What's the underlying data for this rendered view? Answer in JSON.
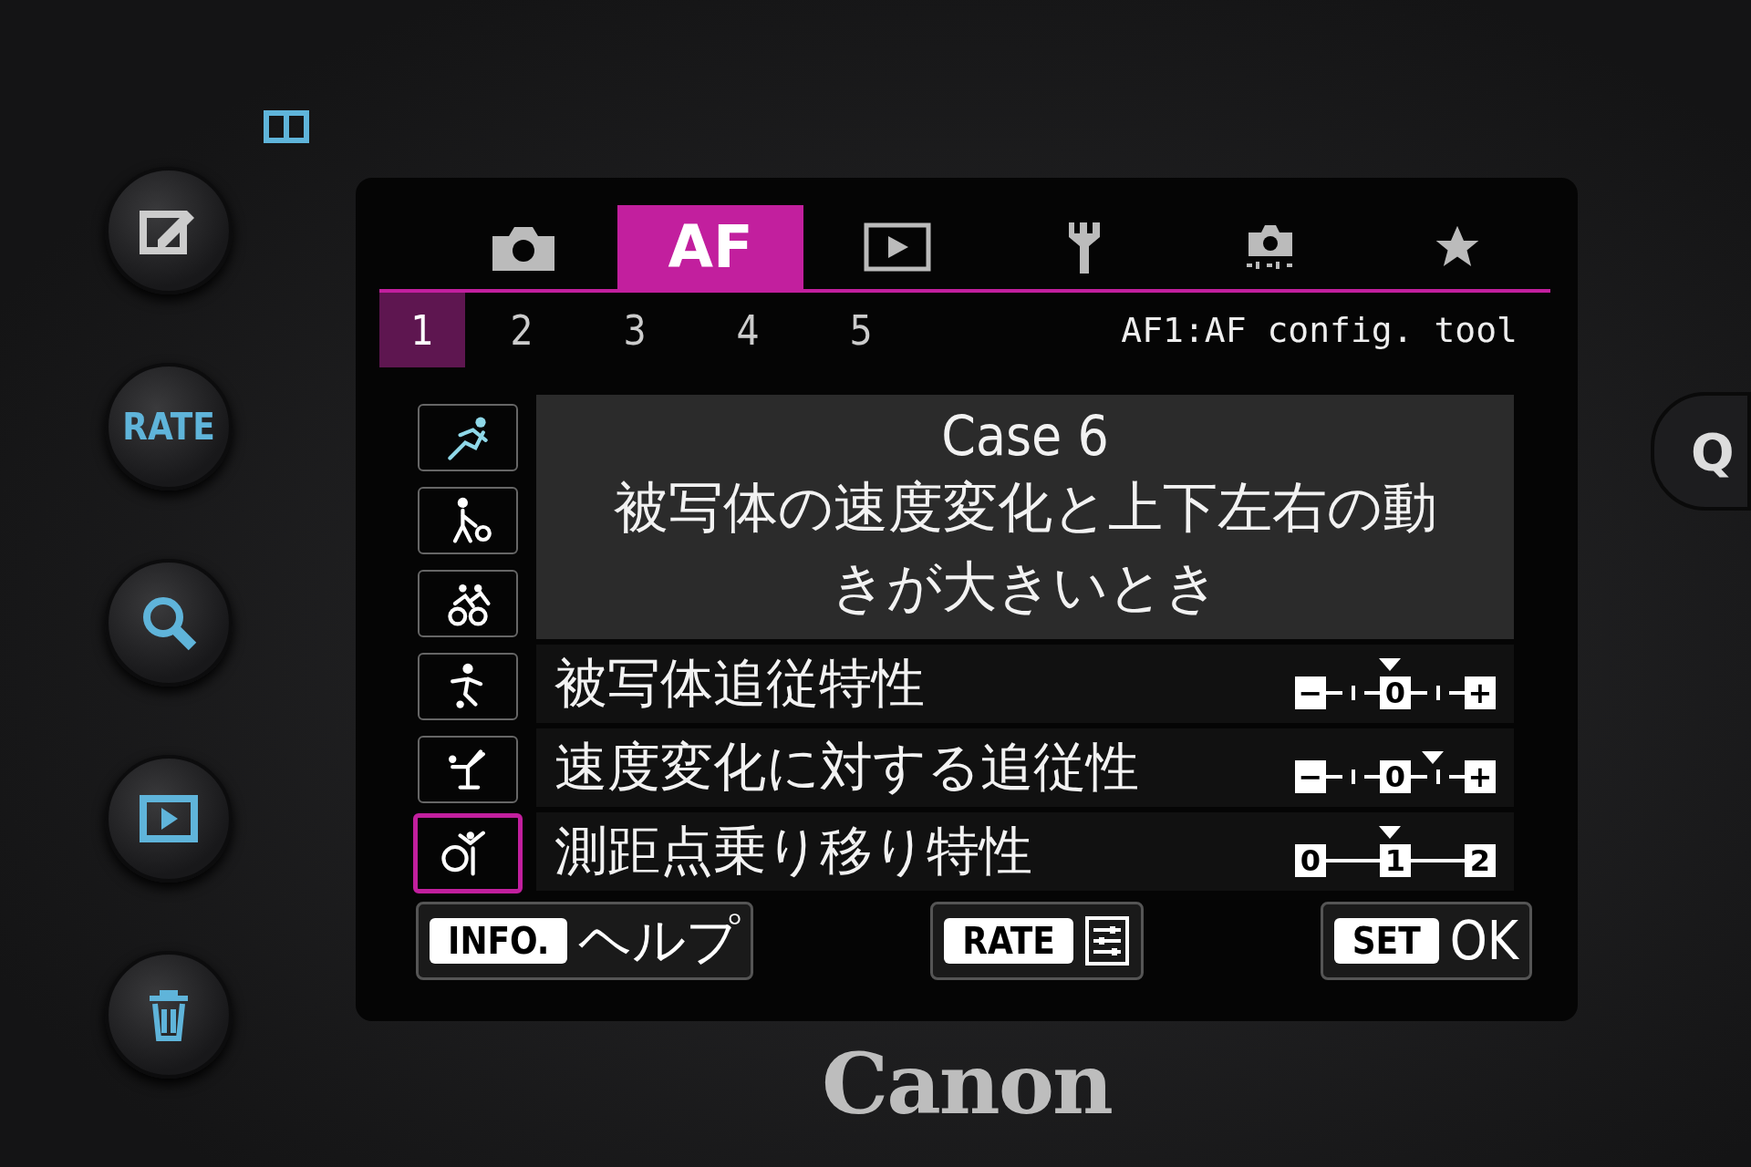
{
  "camera_body": {
    "side_buttons": [
      {
        "kind": "edit"
      },
      {
        "kind": "text",
        "label": "RATE"
      },
      {
        "kind": "zoom"
      },
      {
        "kind": "play"
      },
      {
        "kind": "trash"
      }
    ],
    "right_button": {
      "label": "Q"
    },
    "brand": "Canon"
  },
  "screen": {
    "tabs": [
      {
        "kind": "camera",
        "selected": false
      },
      {
        "kind": "text",
        "label": "AF",
        "selected": true
      },
      {
        "kind": "play",
        "selected": false
      },
      {
        "kind": "wrench",
        "selected": false
      },
      {
        "kind": "custom",
        "selected": false
      },
      {
        "kind": "star",
        "selected": false
      }
    ],
    "subtabs": [
      {
        "label": "1",
        "selected": true
      },
      {
        "label": "2",
        "selected": false
      },
      {
        "label": "3",
        "selected": false
      },
      {
        "label": "4",
        "selected": false
      },
      {
        "label": "5",
        "selected": false
      }
    ],
    "menu_title": "AF1:AF config. tool",
    "cases": [
      {
        "kind": "runner",
        "selected": false,
        "color": "#8fd8e8"
      },
      {
        "kind": "tennis",
        "selected": false,
        "color": "#ffffff"
      },
      {
        "kind": "cyclists",
        "selected": false,
        "color": "#ffffff"
      },
      {
        "kind": "soccer",
        "selected": false,
        "color": "#ffffff"
      },
      {
        "kind": "skater",
        "selected": false,
        "color": "#ffffff"
      },
      {
        "kind": "gymnast",
        "selected": true,
        "color": "#ffffff"
      }
    ],
    "description": {
      "title": "Case 6",
      "text": "被写体の速度変化と上下左右の動きが大きいとき"
    },
    "settings": [
      {
        "label": "被写体追従特性",
        "stops": [
          {
            "label": "−",
            "selected": false
          },
          {
            "selected": false
          },
          {
            "label": "0",
            "selected": true
          },
          {
            "selected": false
          },
          {
            "label": "+",
            "selected": false
          }
        ]
      },
      {
        "label": "速度変化に対する追従性",
        "stops": [
          {
            "label": "−",
            "selected": false
          },
          {
            "selected": false
          },
          {
            "label": "0",
            "selected": false
          },
          {
            "selected": true
          },
          {
            "label": "+",
            "selected": false
          }
        ]
      },
      {
        "label": "測距点乗り移り特性",
        "stops": [
          {
            "label": "0",
            "selected": false
          },
          {
            "label": "1",
            "selected": true
          },
          {
            "label": "2",
            "selected": false
          }
        ]
      }
    ],
    "footer": [
      {
        "key": "INFO.",
        "action": "ヘルプ",
        "kind": "text"
      },
      {
        "key": "RATE",
        "kind": "icon"
      },
      {
        "key": "SET",
        "action": "OK",
        "kind": "text"
      }
    ]
  }
}
